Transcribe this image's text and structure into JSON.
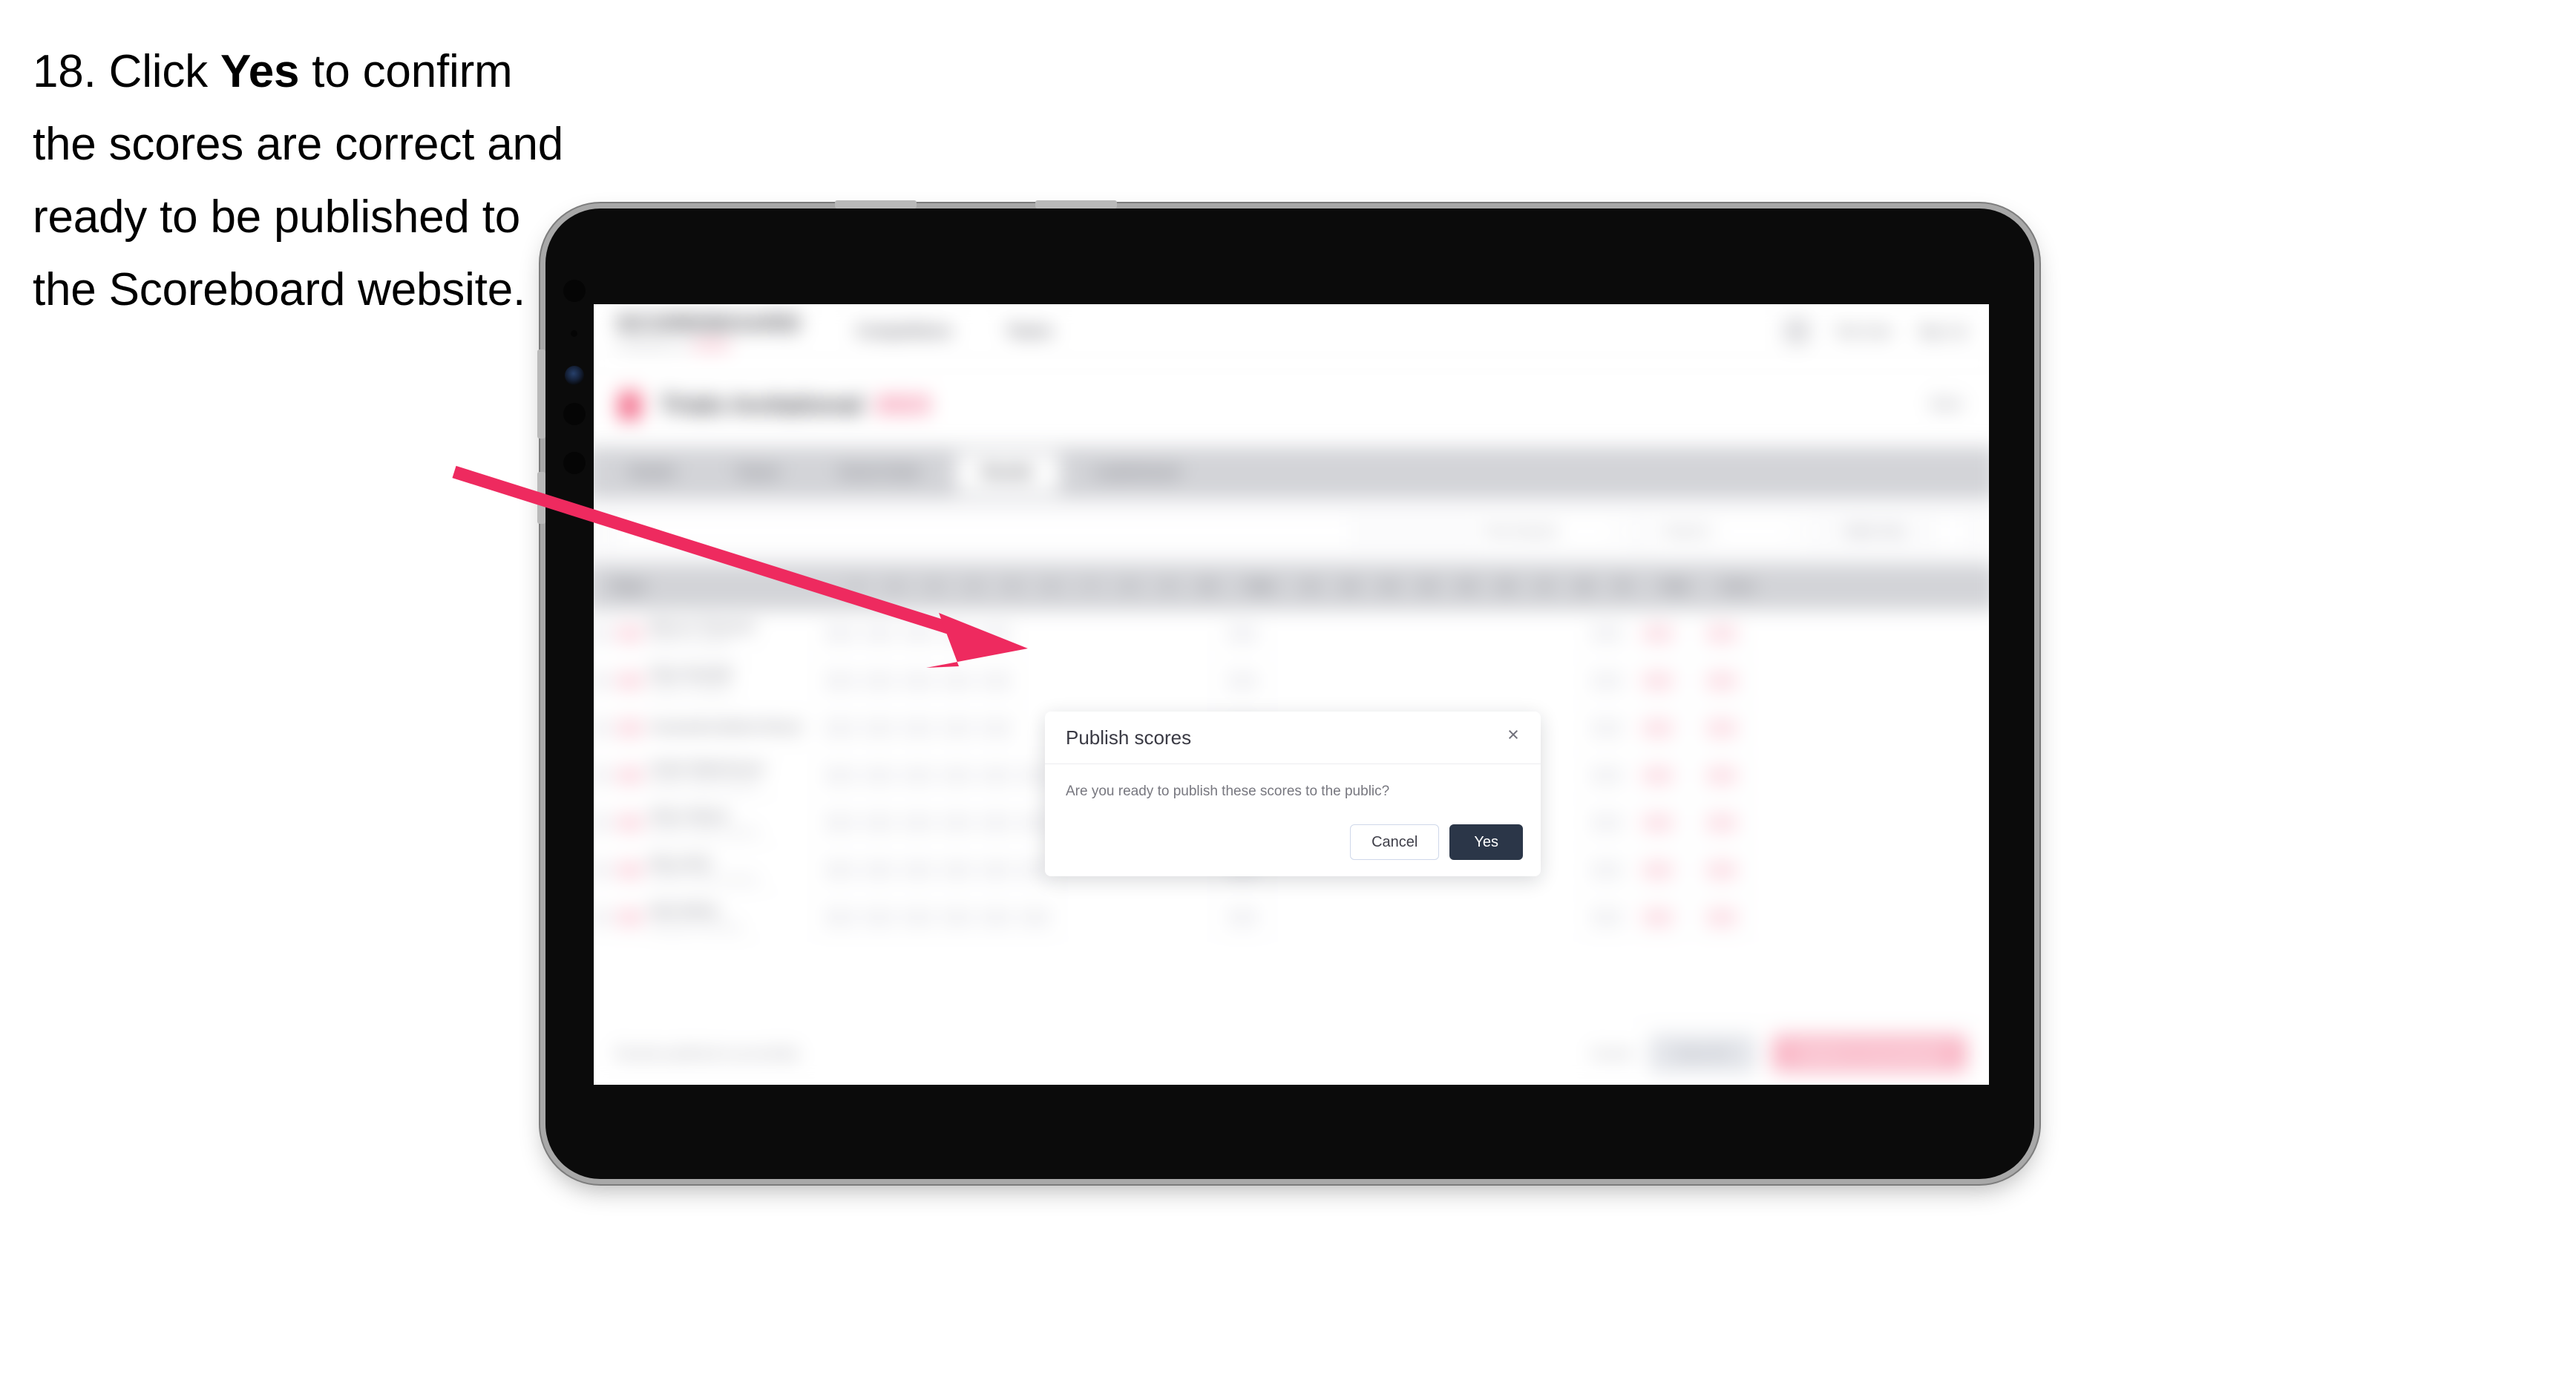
{
  "instruction": {
    "number": "18.",
    "text_before": " Click ",
    "emphasis": "Yes",
    "text_after": " to confirm the scores are correct and ready to be published to the Scoreboard website."
  },
  "colors": {
    "arrow": "#ee2a5f",
    "primary_button": "#2b3648",
    "brand_accent": "#f2678c",
    "publish_button": "#f9b9c8",
    "tabbar": "#d3d4d8"
  },
  "device": {
    "type": "tablet",
    "bezel_color": "#0b0b0b",
    "frame_color": "#a8a8a8"
  },
  "app": {
    "header": {
      "brand": "SCOREBOARD",
      "brand_sub": "POWERED BY",
      "brand_sub_accent": "SPORT",
      "nav": [
        "Competitions",
        "Teams"
      ],
      "user_name": "Test User",
      "sign_out": "Sign out"
    },
    "competition": {
      "name": "Trials Invitational",
      "year": "2023",
      "back_link": "Back"
    },
    "tabs": [
      {
        "label": "Details",
        "active": false
      },
      {
        "label": "Teams",
        "active": false
      },
      {
        "label": "Event Order",
        "active": false
      },
      {
        "label": "Results",
        "active": true
      },
      {
        "label": "Leaderboard",
        "active": false
      }
    ],
    "filters": {
      "search_placeholder": "Search",
      "selects": [
        {
          "label": "First Session"
        },
        {
          "label": "Round 1"
        },
        {
          "label": "Table Only"
        }
      ]
    },
    "table": {
      "columns": [
        "Player",
        "1",
        "2",
        "3",
        "4",
        "5",
        "6",
        "7",
        "8",
        "9",
        "10",
        "Total",
        "11",
        "12",
        "13",
        "14",
        "15",
        "16",
        "17",
        "18",
        "Pt",
        "Total",
        "Score"
      ],
      "rows": [
        {
          "name": "Marcus Thomson",
          "team": "Eastern Crusaders",
          "scores": [
            "4",
            "4",
            "4",
            "4",
            "4",
            "",
            "",
            "",
            "",
            "",
            "80",
            "",
            "",
            "",
            "",
            "",
            "",
            "",
            "",
            "94",
            "95",
            "140",
            "168"
          ]
        },
        {
          "name": "Piper Randall",
          "team": "Eastern Crusaders",
          "scores": [
            "4",
            "4",
            "4",
            "4",
            "4",
            "",
            "",
            "",
            "",
            "",
            "80",
            "",
            "",
            "",
            "",
            "",
            "",
            "",
            "",
            "94",
            "95",
            "140",
            "168"
          ]
        },
        {
          "name": "Cassandra Barker-Rosen",
          "team": "",
          "scores": [
            "4",
            "4",
            "4",
            "4",
            "4",
            "",
            "",
            "",
            "",
            "",
            "80",
            "",
            "",
            "",
            "",
            "",
            "",
            "",
            "",
            "94",
            "95",
            "140",
            "168"
          ]
        },
        {
          "name": "Calvin Waterhouse",
          "team": "Northern Lights Academy",
          "scores": [
            "4",
            "4",
            "4",
            "4",
            "4",
            "4",
            "",
            "",
            "",
            "",
            "80",
            "",
            "",
            "",
            "",
            "",
            "",
            "",
            "",
            "94",
            "95",
            "140",
            "168"
          ]
        },
        {
          "name": "Oliver Nkemi",
          "team": "Northern Lights Academy",
          "scores": [
            "4",
            "4",
            "4",
            "4",
            "4",
            "4",
            "",
            "",
            "",
            "",
            "80",
            "",
            "",
            "",
            "",
            "",
            "",
            "",
            "",
            "104",
            "95",
            "140",
            "168"
          ]
        },
        {
          "name": "Rhys Britt",
          "team": "Northern Lights Academy",
          "scores": [
            "4",
            "4",
            "4",
            "4",
            "4",
            "4",
            "",
            "",
            "",
            "",
            "80",
            "",
            "",
            "",
            "",
            "",
            "",
            "",
            "",
            "94",
            "95",
            "140",
            "168"
          ]
        },
        {
          "name": "Nate Bailey",
          "team": "Westside Community",
          "scores": [
            "4",
            "4",
            "4",
            "4",
            "4",
            "4",
            "",
            "",
            "",
            "",
            "80",
            "",
            "",
            "",
            "",
            "",
            "",
            "",
            "",
            "94",
            "95",
            "140",
            "168"
          ]
        }
      ]
    },
    "action_bar": {
      "note": "Results published successfully",
      "cancel": "Cancel",
      "save": "Save All",
      "publish": "Publish to Scoreboard"
    }
  },
  "modal": {
    "title": "Publish scores",
    "body": "Are you ready to publish these scores to the public?",
    "close_icon": "×",
    "cancel_label": "Cancel",
    "confirm_label": "Yes"
  }
}
